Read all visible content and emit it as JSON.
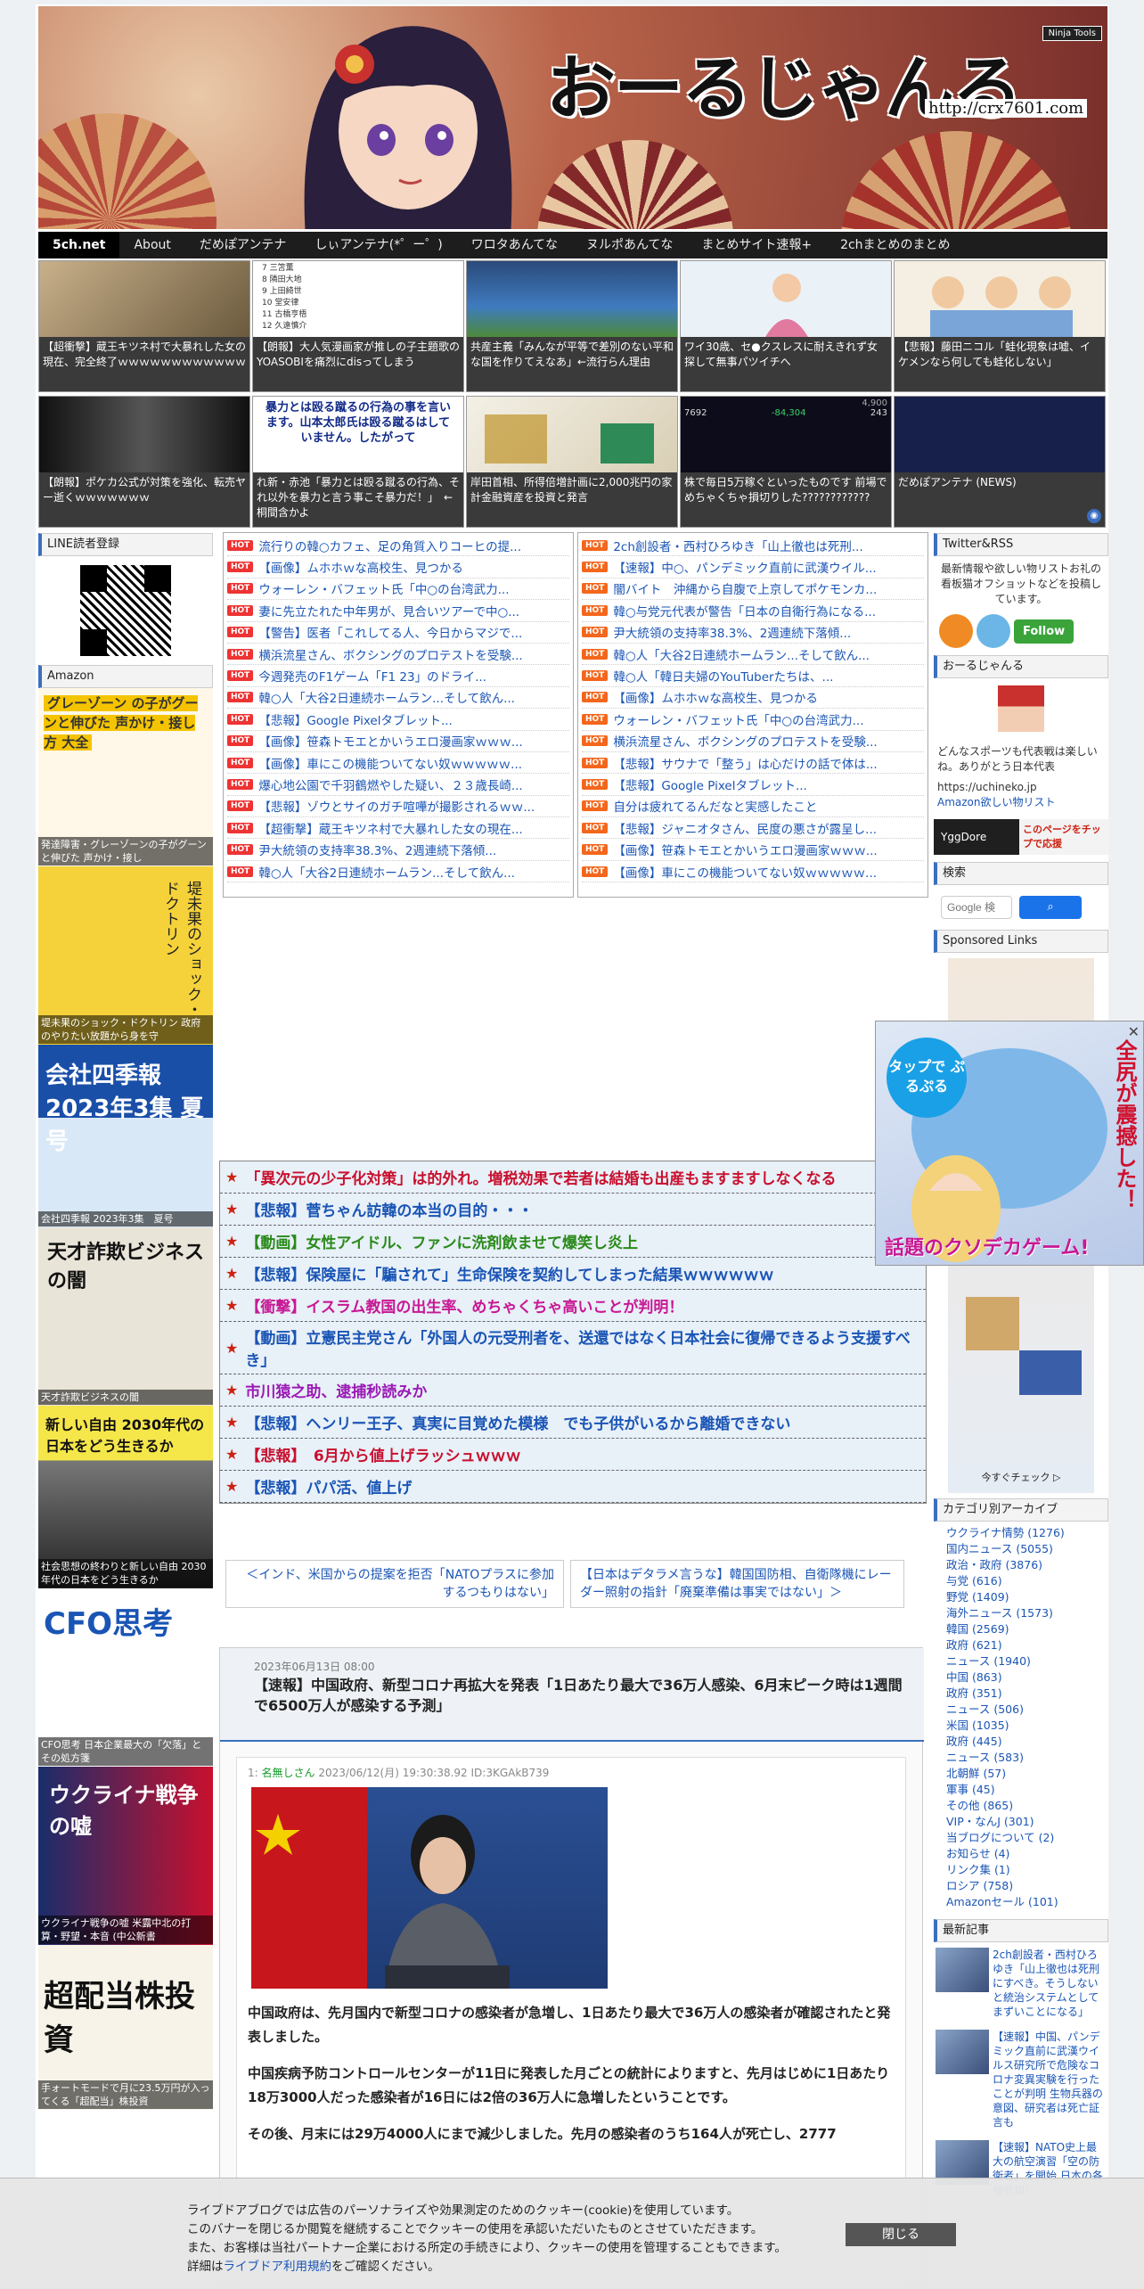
{
  "header": {
    "title": "おーるじゃんる",
    "url": "http://crx7601.com",
    "ninja": "Ninja Tools"
  },
  "nav": [
    "5ch.net",
    "About",
    "だめぽアンテナ",
    "しぃアンテナ(*゜ー゜)",
    "ワロタあんてな",
    "ヌルポあんてな",
    "まとめサイト速報+",
    "2chまとめのまとめ"
  ],
  "tiles_row1": [
    "【超衝撃】蔵王キツネ村で大暴れした女の現在、完全終了ｗｗｗｗｗｗｗｗｗｗｗｗ",
    "【朗報】大人気漫画家が推しの子主題歌のYOASOBIを痛烈にdisってしまう",
    "共産主義「みんなが平等で差別のない平和な国を作りてえなあ」←流行らん理由",
    "ワイ30歳、セ●クスレスに耐えきれず女探して無事パツイチへ",
    "【悲報】藤田ニコル「蛙化現象は嘘、イケメンなら何しても蛙化しない」"
  ],
  "tiles_row1_list": [
    "7 三笘薫",
    "8 隣田大地",
    "9 上田綺世",
    "10 堂安律",
    "11 古橋亨梧",
    "12 久遠慎介"
  ],
  "tiles_row2": [
    "【朗報】ポケカ公式が対策を強化、転売ヤー逝くｗｗｗｗｗｗｗ",
    "れ新・赤池「暴力とは殴る蹴るの行為、それ以外を暴力と言う事こそ暴力だ！」　←桐間含かよ",
    "岸田首相、所得倍増計画に2,000兆円の家計金融資産を投資と発言",
    "株で毎日5万稼ぐといったものです 前場でめちゃくちゃ損切りした????????????",
    "だめぽアンテナ (NEWS)"
  ],
  "tile2_quote": "暴力とは殴る蹴るの行為の事を言います。山本太郎氏は殴る蹴るはしていません。したがって",
  "tile4_ticker": [
    "7692",
    "-84,304",
    "243",
    "4,900"
  ],
  "left": {
    "line_title": "LINE読者登録",
    "amazon_title": "Amazon",
    "books": [
      {
        "cover": "グレーゾーン の子がグーンと伸びた 声かけ・接し方 大全",
        "cap": "発達障害・グレーゾーンの子がグーンと伸びた 声かけ・接し"
      },
      {
        "cover": "堤未果のショック・ドクトリン",
        "cap": "堤未果のショック・ドクトリン 政府のやりたい放題から身を守"
      },
      {
        "cover": "会社四季報 2023年3集 夏号",
        "cap": "会社四季報 2023年3集　夏号"
      },
      {
        "cover": "天才詐欺ビジネスの闇",
        "cap": "天才詐欺ビジネスの闇"
      },
      {
        "cover": "新しい自由 2030年代の日本をどう生きるか",
        "cap": "社会思想の終わりと新しい自由 2030年代の日本をどう生きるか"
      },
      {
        "cover": "CFO思考",
        "cap": "CFO思考 日本企業最大の「欠落」とその処方箋"
      },
      {
        "cover": "ウクライナ戦争の嘘",
        "cap": "ウクライナ戦争の嘘 米露中北の打算・野望・本音 (中公新書"
      },
      {
        "cover": "超配当株投資",
        "cap": "手ォートモードで月に23.5万円が入ってくる「超配当」株投資"
      }
    ]
  },
  "hot_left": [
    "流行りの韓○カフェ、足の角質入りコーヒの提...",
    "【画像】ムホホｗな高校生、見つかる",
    "ウォーレン・バフェット氏「中○の台湾武力...",
    "妻に先立たれた中年男が、見合いツアーで中○...",
    "【警告】医者「これしてる人、今日からマジで...",
    "横浜流星さん、ボクシングのプロテストを受験...",
    "今週発売のF1ゲーム「F1 23」のドライ...",
    "韓○人「大谷2日連続ホームラン...そして飲ん...",
    "【悲報】Google Pixelタブレット...",
    "【画像】笹森トモエとかいうエロ漫画家ｗｗｗ...",
    "【画像】車にこの機能ついてない奴ｗｗｗｗｗ...",
    "爆心地公園で千羽鶴燃やした疑い、２３歳長崎...",
    "【悲報】ゾウとサイのガチ喧嘩が撮影されるｗｗ...",
    "【超衝撃】蔵王キツネ村で大暴れした女の現在...",
    "尹大統領の支持率38.3%、2週連続下落傾...",
    "韓○人「大谷2日連続ホームラン...そして飲ん..."
  ],
  "hot_right": [
    "2ch創設者・西村ひろゆき「山上徹也は死刑...",
    "【速報】中○、パンデミック直前に武漢ウイル...",
    "闇バイト　沖縄から自腹で上京してポケモンカ...",
    "韓○与党元代表が警告「日本の自衛行為になる...",
    "尹大統領の支持率38.3%、2週連続下落傾...",
    "韓○人「大谷2日連続ホームラン...そして飲ん...",
    "韓○人「韓日夫婦のYouTuberたちは、...",
    "【画像】ムホホｗな高校生、見つかる",
    "ウォーレン・バフェット氏「中○の台湾武力...",
    "横浜流星さん、ボクシングのプロテストを受験...",
    "【悲報】サウナで「整う」は心だけの話で体は...",
    "【悲報】Google Pixelタブレット...",
    "自分は疲れてるんだなと実感したこと",
    "【悲報】ジャニオタさん、民度の悪さが露呈し...",
    "【画像】笹森トモエとかいうエロ漫画家ｗｗｗ...",
    "【画像】車にこの機能ついてない奴ｗｗｗｗｗ..."
  ],
  "hot_label": "HOT",
  "features": [
    {
      "text": "「異次元の少子化対策」は的外れ。増税効果で若者は結婚も出産もますますしなくなる",
      "color": "#c8102e"
    },
    {
      "text": "【悲報】菅ちゃん訪韓の本当の目的・・・",
      "color": "#1a55b5"
    },
    {
      "text": "【動画】女性アイドル、ファンに洗剤飲ませて爆笑し炎上",
      "color": "#2a8a1a"
    },
    {
      "text": "【悲報】保険屋に「騙されて」生命保険を契約してしまった結果ｗｗｗｗｗｗ",
      "color": "#1a55b5"
    },
    {
      "text": "【衝撃】イスラム教国の出生率、めちゃくちゃ高いことが判明！",
      "color": "#c81894"
    },
    {
      "text": "【動画】立憲民主党さん「外国人の元受刑者を、送還ではなく日本社会に復帰できるよう支援すべき」",
      "color": "#1a55b5"
    },
    {
      "text": "市川猿之助、逮捕秒読みか",
      "color": "#9a1ab5"
    },
    {
      "text": "【悲報】ヘンリー王子、真実に目覚めた模様　でも子供がいるから離婚できない",
      "color": "#1a55b5"
    },
    {
      "text": "【悲報】　6月から値上げラッシュｗｗｗ",
      "color": "#c8102e"
    },
    {
      "text": "【悲報】パパ活、値上げ",
      "color": "#1a55b5"
    }
  ],
  "prev": "＜インド、米国からの提案を拒否「NATOプラスに参加するつもりはない」",
  "next": "【日本はデタラメ言うな】韓国国防相、自衛隊機にレーダー照射の指針「廃棄準備は事実ではない」＞",
  "article": {
    "date": "2023年06月13日 08:00",
    "title": "【速報】中国政府、新型コロナ再拡大を発表「1日あたり最大で36万人感染、6月末ピーク時は1週間で6500万人が感染する予測」",
    "meta_num": "1:",
    "meta_name": "名無しさん",
    "meta_rest": "2023/06/12(月) 19:30:38.92 ID:3KGAkB739",
    "p1": "中国政府は、先月国内で新型コロナの感染者が急増し、1日あたり最大で36万人の感染者が確認されたと発表しました。",
    "p2": "中国疾病予防コントロールセンターが11日に発表した月ごとの統計によりますと、先月はじめに1日あたり18万3000人だった感染者が16日には2倍の36万人に急増したということです。",
    "p3": "その後、月末には29万4000人にまで減少しました。先月の感染者のうち164人が死亡し、2777"
  },
  "right": {
    "twitter_title": "Twitter&RSS",
    "twitter_text": "最新情報や欲しい物リストお礼の看板猫オフショットなどを投稿しています。",
    "follow": "Follow",
    "profile_title": "おーるじゃんる",
    "profile_text": "どんなスポーツも代表戦は楽しいね。ありがとう日本代表",
    "profile_link": "https://uchineko.jp",
    "wishlist": "Amazon欲しい物リスト",
    "yggdore": "YggDore",
    "tip": "このページをチップで応援",
    "search_title": "検索",
    "search_placeholder": "Google 検",
    "sponsored_title": "Sponsored Links",
    "sponsored_check": "今すぐチェック ▷",
    "archive_title": "カテゴリ別アーカイブ",
    "categories": [
      "ウクライナ情勢 (1276)",
      "国内ニュース (5055)",
      "政治・政府 (3876)",
      "与党 (616)",
      "野党 (1409)",
      "海外ニュース (1573)",
      "韓国 (2569)",
      "政府 (621)",
      "ニュース (1940)",
      "中国 (863)",
      "政府 (351)",
      "ニュース (506)",
      "米国 (1035)",
      "政府 (445)",
      "ニュース (583)",
      "北朝鮮 (57)",
      "軍事 (45)",
      "その他 (865)",
      "VIP・なんJ (301)",
      "当ブログについて (2)",
      "お知らせ (4)",
      "リンク集 (1)",
      "ロシア (758)",
      "Amazonセール (101)"
    ],
    "latest_title": "最新記事",
    "latest": [
      "2ch創設者・西村ひろゆき「山上徹也は死刑にすべき。そうしないと統治システムとしてまずいことになる」",
      "【速報】中国、パンデミック直前に武漢ウイルス研究所で危険なコロナ変異実験を行ったことが判明 生物兵器の意図、研究者は死亡証言も",
      "【速報】NATO史上最大の航空演習「空の防衛者」を開始 日本の各種参加！"
    ]
  },
  "ad": {
    "tap": "タップで ぷるぷる",
    "big": "全尻が震撼した！",
    "caption": "話題のクソデカゲーム!"
  },
  "cookie": {
    "lines": [
      "ライブドアブログでは広告のパーソナライズや効果測定のためのクッキー(cookie)を使用しています。",
      "このバナーを閉じるか閲覧を継続することでクッキーの使用を承認いただいたものとさせていただきます。",
      "また、お客様は当社パートナー企業における所定の手続きにより、クッキーの使用を管理することもできます。"
    ],
    "detail_pre": "詳細は",
    "detail_link": "ライブドア利用規約",
    "detail_post": "をご確認ください。",
    "close": "閉じる"
  },
  "colors": {
    "accent": "#3a6fc0",
    "hot_left": "#e33333",
    "hot_right": "#f4661b",
    "nav_bg": "#1d1d1d"
  }
}
